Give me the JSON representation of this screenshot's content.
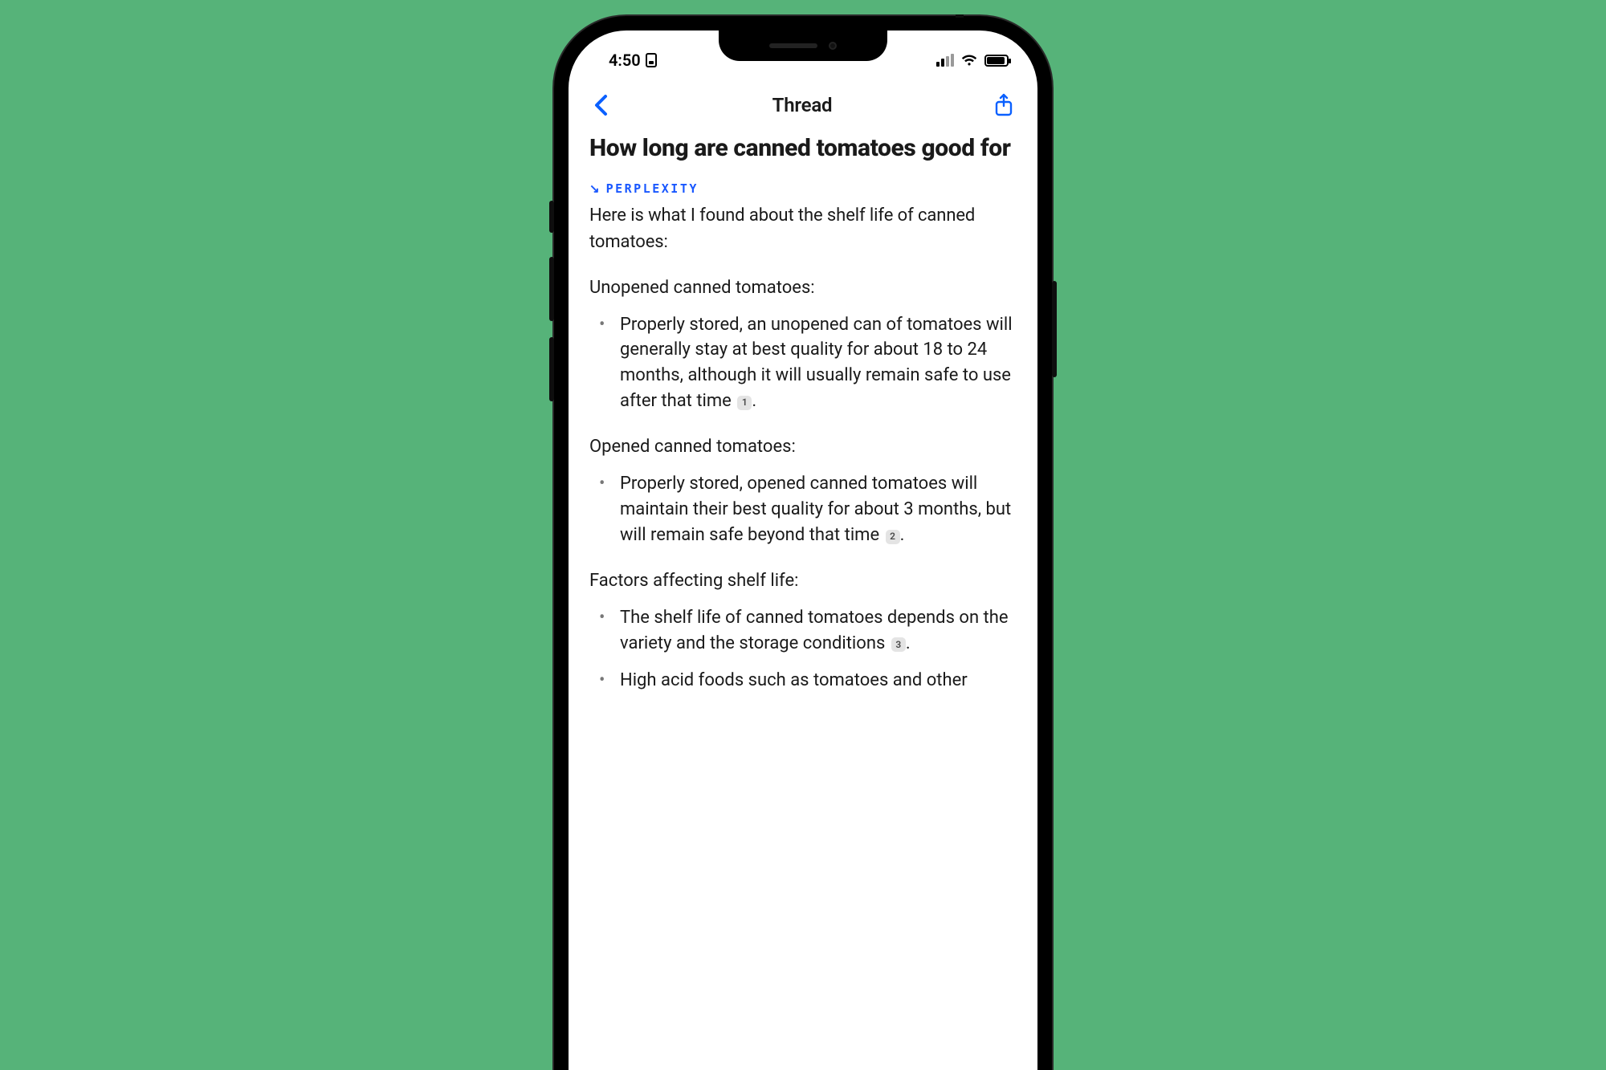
{
  "status": {
    "time": "4:50",
    "sim_label": ""
  },
  "nav": {
    "title": "Thread"
  },
  "thread": {
    "question": "How long are canned tomatoes good for",
    "source_label": "PERPLEXITY",
    "intro": "Here is what I found about the shelf life of canned tomatoes:",
    "sections": [
      {
        "heading": "Unopened canned tomatoes:",
        "bullets": [
          {
            "text_pre": "Properly stored, an unopened can of tomatoes will generally stay at best quality for about 18 to 24 months, although it will usually remain safe to use after that time",
            "cite": "1",
            "text_post": "."
          }
        ]
      },
      {
        "heading": "Opened canned tomatoes:",
        "bullets": [
          {
            "text_pre": "Properly stored, opened canned tomatoes will maintain their best quality for about 3 months, but will remain safe beyond that time",
            "cite": "2",
            "text_post": "."
          }
        ]
      },
      {
        "heading": "Factors affecting shelf life:",
        "bullets": [
          {
            "text_pre": "The shelf life of canned tomatoes depends on the variety and the storage conditions",
            "cite": "3",
            "text_post": "."
          },
          {
            "text_pre": "High acid foods such as tomatoes and other",
            "cite": null,
            "text_post": ""
          }
        ]
      }
    ]
  }
}
